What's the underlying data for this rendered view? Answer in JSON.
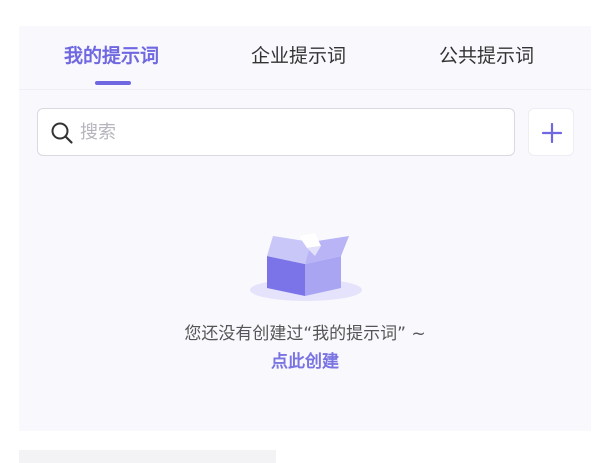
{
  "tabs": [
    {
      "label": "我的提示词",
      "active": true
    },
    {
      "label": "企业提示词",
      "active": false
    },
    {
      "label": "公共提示词",
      "active": false
    }
  ],
  "search": {
    "placeholder": "搜索",
    "value": ""
  },
  "icons": {
    "search": "search-icon",
    "add": "plus-icon",
    "empty": "empty-box-icon"
  },
  "empty_state": {
    "message": "您还没有创建过“我的提示词” ~",
    "action_label": "点此创建"
  },
  "colors": {
    "accent": "#6f68e0",
    "panel_bg": "#f8f8fd",
    "text": "#333333"
  }
}
